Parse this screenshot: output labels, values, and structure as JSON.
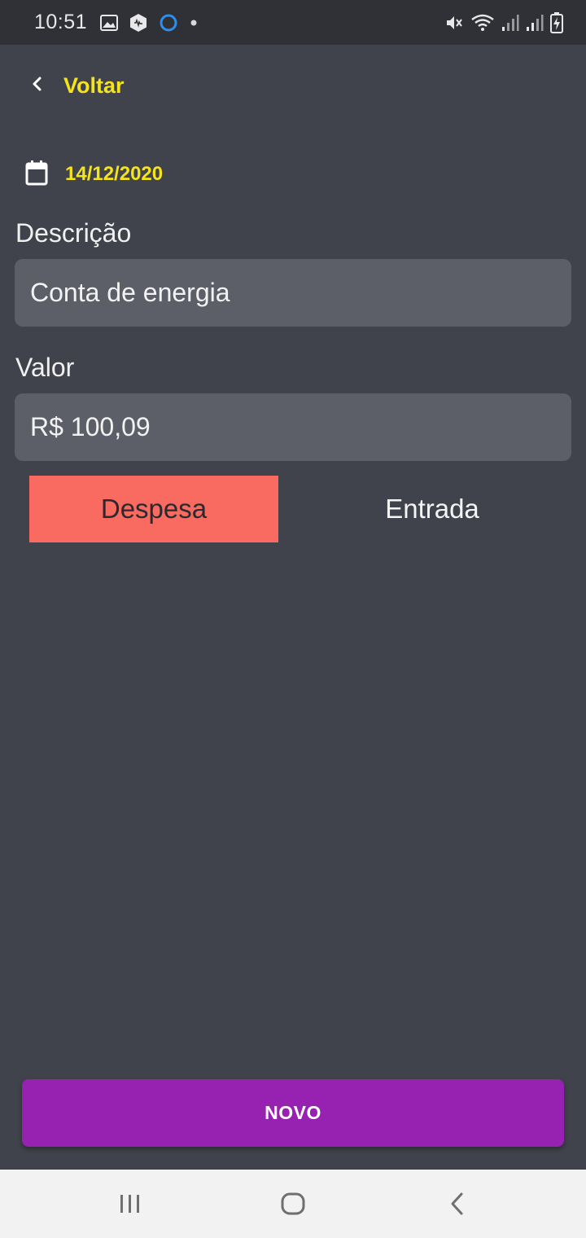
{
  "status_bar": {
    "time": "10:51",
    "left_icons": [
      "gallery-icon",
      "app-hex-icon",
      "circle-ring-icon",
      "dot-icon"
    ],
    "right_icons": [
      "mute-icon",
      "wifi-icon",
      "signal-icon",
      "signal-icon",
      "battery-charging-icon"
    ]
  },
  "header": {
    "back_icon": "chevron-left-icon",
    "back_label": "Voltar"
  },
  "date": {
    "icon": "calendar-icon",
    "value": "14/12/2020"
  },
  "form": {
    "description": {
      "label": "Descrição",
      "value": "Conta de energia"
    },
    "amount": {
      "label": "Valor",
      "value": "R$ 100,09"
    },
    "type_toggle": {
      "options": [
        "Despesa",
        "Entrada"
      ],
      "selected": "Despesa"
    }
  },
  "actions": {
    "primary_label": "NOVO"
  },
  "colors": {
    "background": "#40434c",
    "accent_yellow": "#f5e31b",
    "input_bg": "#5c5f68",
    "expense_active": "#f96a61",
    "primary_button": "#9722b1"
  },
  "nav_bar": {
    "icons": [
      "recent-apps-icon",
      "home-icon",
      "back-icon"
    ]
  }
}
